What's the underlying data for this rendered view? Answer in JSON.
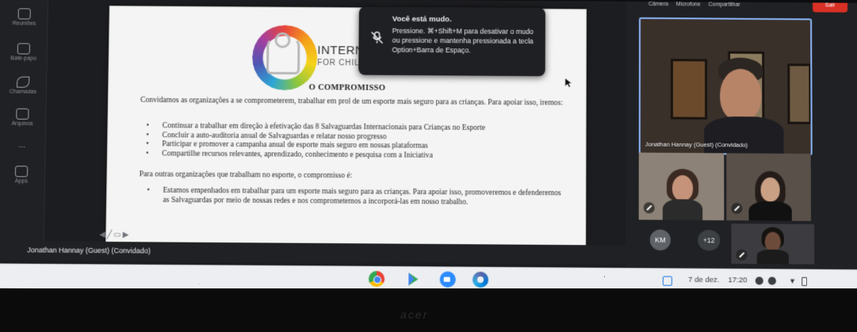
{
  "rail": {
    "items": [
      {
        "icon": "calendar-icon",
        "label": "Reuniões"
      },
      {
        "icon": "chat-icon",
        "label": "Bate-papo"
      },
      {
        "icon": "phone-icon",
        "label": "Chamadas"
      },
      {
        "icon": "files-icon",
        "label": "Arquivos"
      },
      {
        "icon": "more-icon",
        "label": "..."
      },
      {
        "icon": "apps-icon",
        "label": "Apps"
      }
    ]
  },
  "slide": {
    "brand_line1": "INTERNA",
    "brand_line2": "FOR CHIL",
    "title": "O COMPROMISSO",
    "intro": "Convidamos as organizações a se comprometerem, trabalhar em prol de um esporte mais seguro para as crianças. Para apoiar isso, iremos:",
    "bullets": [
      "Continuar a trabalhar em direção à efetivação das 8 Salvaguardas Internacionais para Crianças no Esporte",
      "Concluir a auto-auditoria anual de Salvaguardas e relatar nosso progresso",
      "Participar e promover a campanha anual de esporte mais seguro em nossas plataformas",
      "Compartilhe recursos relevantes, aprendizado, conhecimento e pesquisa com a Iniciativa"
    ],
    "other_intro": "Para outras organizações que trabalham no esporte, o compromisso é:",
    "commitment": "Estamos empenhados em trabalhar para um esporte mais seguro para as crianças. Para apoiar isso, promoveremos e defenderemos as Salvaguardas por meio de nossas redes e nos comprometemos a incorporá-las em nosso trabalho."
  },
  "toast": {
    "title": "Você está mudo.",
    "body": "Pressione. ⌘+Shift+M para desativar o mudo ou pressione e mantenha pressionada a tecla Option+Barra de Espaço."
  },
  "presenter": {
    "name": "Jonathan Hannay (Guest) (Convidado)"
  },
  "top_controls": {
    "camera": "Câmera",
    "mic": "Microfone",
    "share": "Compartilhar",
    "leave": "Sair"
  },
  "tiles": {
    "main_name": "Jonathan Hannay (Guest) (Convidado)",
    "km_initials": "KM",
    "more_count": "+12"
  },
  "shelf": {
    "date": "7 de dez.",
    "time": "17:20",
    "apps": [
      "chrome-icon",
      "play-store-icon",
      "zoom-icon",
      "webex-icon"
    ]
  },
  "bezel": {
    "brand": "acer"
  },
  "colors": {
    "accent": "#8ab4f8",
    "leave": "#d93025"
  }
}
